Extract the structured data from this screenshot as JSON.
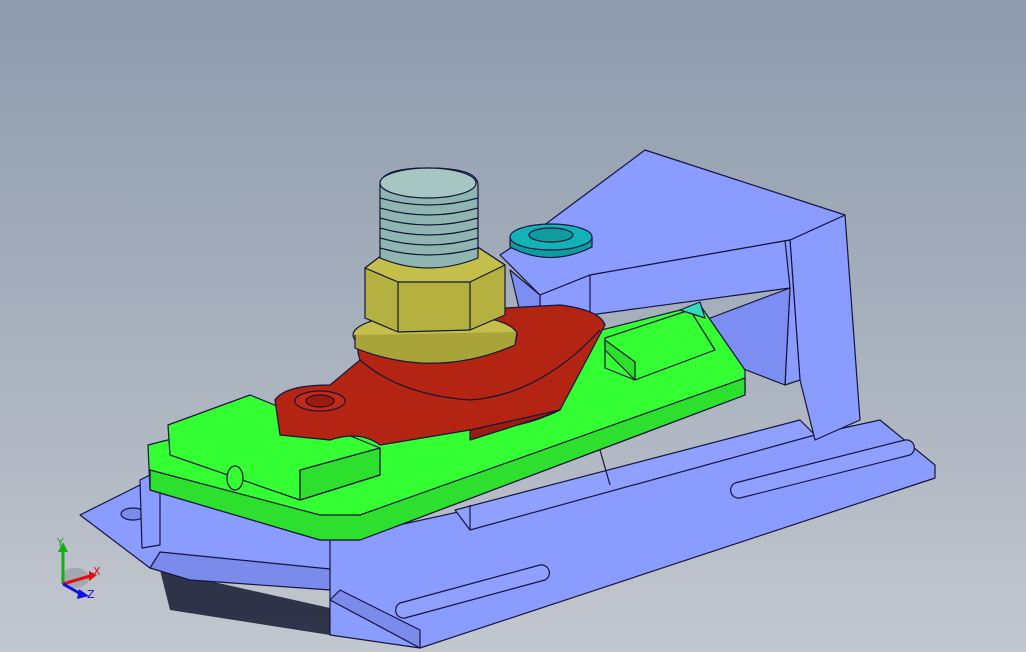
{
  "viewport": {
    "background_top": "#8e9bad",
    "background_bottom": "#c3c7cf"
  },
  "model": {
    "colors": {
      "fixture_body": "#8a9cff",
      "clamp_plate": "#33ff33",
      "clamp_block": "#b32412",
      "hex_nut": "#b5b140",
      "threaded_stud": "#8fb5b0",
      "washer": "#11b3b8",
      "edge": "#15153a"
    },
    "parts": [
      "fixture-base",
      "clamp-arm",
      "green-clamp-plate",
      "red-clamp-block",
      "hex-nut",
      "threaded-stud",
      "washer"
    ]
  },
  "triad": {
    "x_label": "X",
    "y_label": "Y",
    "z_label": "Z",
    "x_color": "#e01010",
    "y_color": "#10b010",
    "z_color": "#1010e0"
  }
}
